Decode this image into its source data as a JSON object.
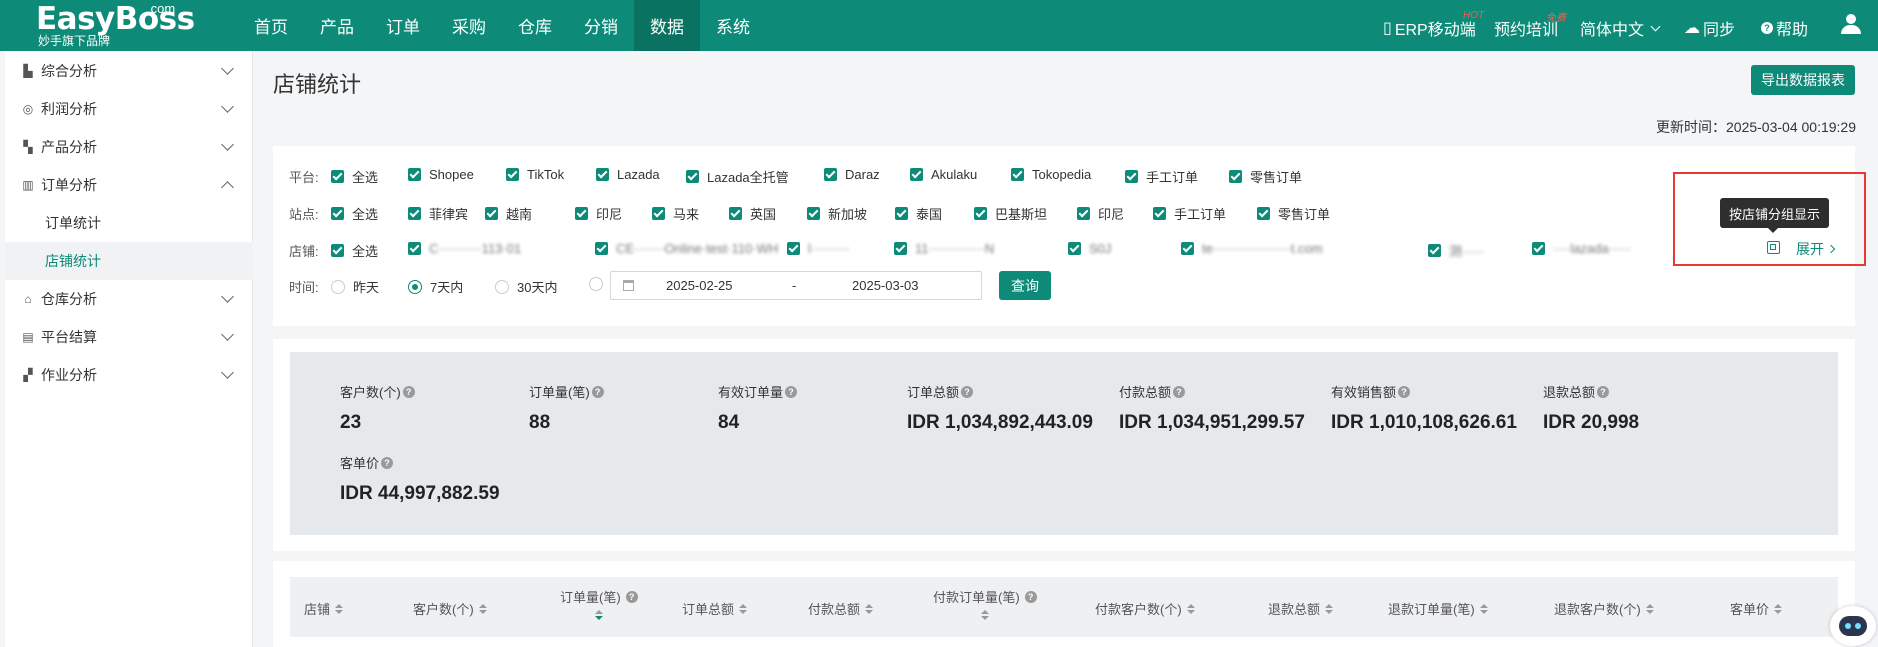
{
  "header": {
    "brand": "EasyBoss",
    "brand_suffix": ".com",
    "brand_sub": "妙手旗下品牌",
    "nav": [
      "首页",
      "产品",
      "订单",
      "采购",
      "仓库",
      "分销",
      "数据",
      "系统"
    ],
    "active_nav": "数据",
    "right": {
      "erp_mobile": "ERP移动端",
      "erp_badge": "HOT",
      "training": "预约培训",
      "training_badge": "免费",
      "language": "简体中文",
      "sync": "同步",
      "help": "帮助"
    }
  },
  "sidebar": {
    "items": [
      {
        "label": "综合分析",
        "expanded": false
      },
      {
        "label": "利润分析",
        "expanded": false
      },
      {
        "label": "产品分析",
        "expanded": false
      },
      {
        "label": "订单分析",
        "expanded": true
      },
      {
        "label": "仓库分析",
        "expanded": false
      },
      {
        "label": "平台结算",
        "expanded": false
      },
      {
        "label": "作业分析",
        "expanded": false
      }
    ],
    "sub_items": [
      {
        "label": "订单统计",
        "active": false
      },
      {
        "label": "店铺统计",
        "active": true
      }
    ]
  },
  "page": {
    "title": "店铺统计",
    "export_label": "导出数据报表",
    "update_time": "更新时间：2025-03-04 00:19:29"
  },
  "filters": {
    "platform_label": "平台:",
    "platforms": [
      "全选",
      "Shopee",
      "TikTok",
      "Lazada",
      "Lazada全托管",
      "Daraz",
      "Akulaku",
      "Tokopedia",
      "手工订单",
      "零售订单"
    ],
    "site_label": "站点:",
    "sites": [
      "全选",
      "菲律宾",
      "越南",
      "印尼",
      "马来",
      "英国",
      "新加坡",
      "泰国",
      "巴基斯坦",
      "印尼",
      "手工订单",
      "零售订单"
    ],
    "shop_label": "店铺:",
    "shops": [
      "全选",
      "C··········113·01",
      "CE·······Online·test·110·WH",
      "l·········",
      "11·············N",
      "S0J",
      "te··················t.com",
      "测·····",
      "····lazada·····"
    ],
    "time_label": "时间:",
    "time_options": [
      "昨天",
      "7天内",
      "30天内"
    ],
    "time_selected": "7天内",
    "date_start": "2025-02-25",
    "date_sep": "-",
    "date_end": "2025-03-03",
    "query_label": "查询",
    "tooltip": "按店铺分组显示",
    "expand_label": "展开"
  },
  "stats": [
    {
      "label": "客户数(个)",
      "value": "23"
    },
    {
      "label": "订单量(笔)",
      "value": "88"
    },
    {
      "label": "有效订单量",
      "value": "84"
    },
    {
      "label": "订单总额",
      "value": "IDR 1,034,892,443.09"
    },
    {
      "label": "付款总额",
      "value": "IDR 1,034,951,299.57"
    },
    {
      "label": "有效销售额",
      "value": "IDR 1,010,108,626.61"
    },
    {
      "label": "退款总额",
      "value": "IDR 20,998"
    },
    {
      "label": "客单价",
      "value": "IDR 44,997,882.59"
    }
  ],
  "table": {
    "columns": [
      "店铺",
      "客户数(个)",
      "订单量(笔)",
      "订单总额",
      "付款总额",
      "付款订单量(笔)",
      "付款客户数(个)",
      "退款总额",
      "退款订单量(笔)",
      "退款客户数(个)",
      "客单价"
    ]
  },
  "colors": {
    "primary": "#0d8a78",
    "header": "#0d8a78",
    "highlight": "#e53935"
  }
}
